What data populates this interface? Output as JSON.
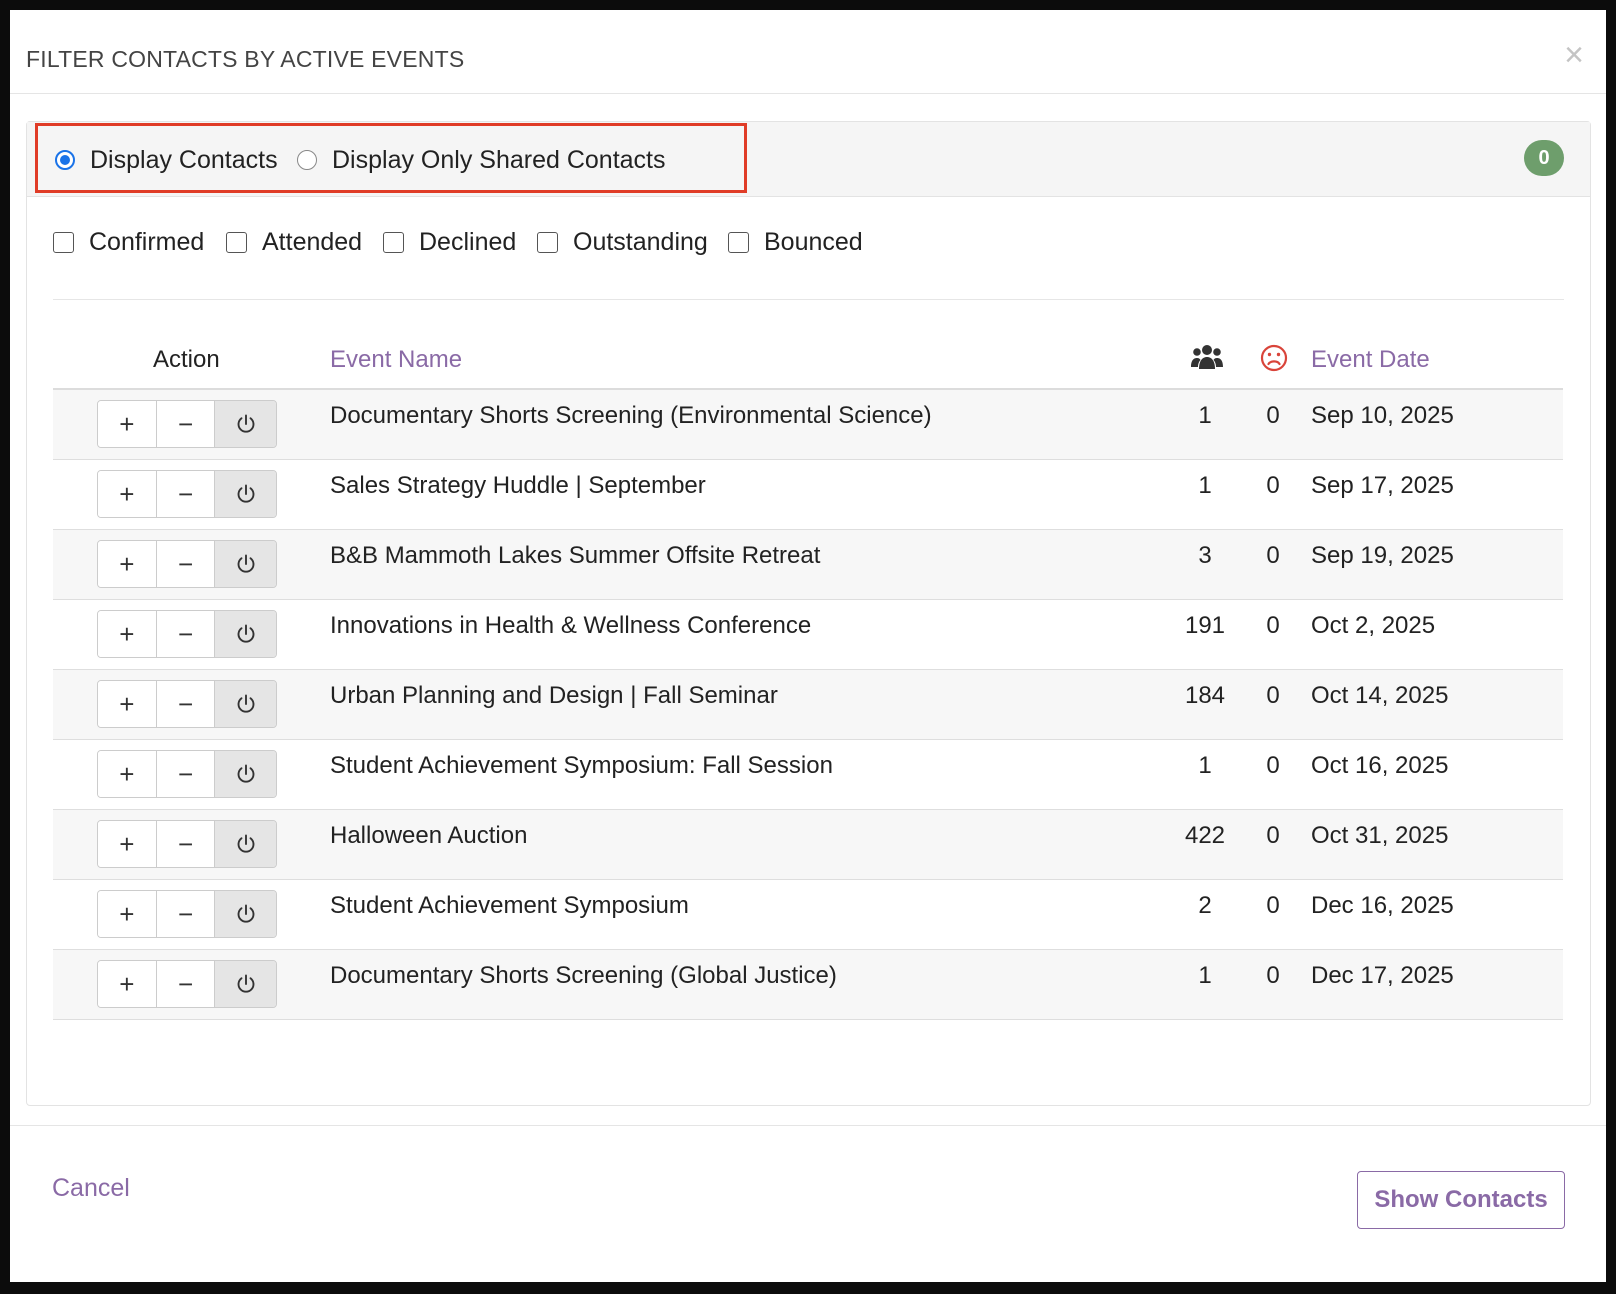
{
  "modal": {
    "title": "FILTER CONTACTS BY ACTIVE EVENTS",
    "close_label": "×"
  },
  "display": {
    "options": [
      {
        "label": "Display Contacts",
        "checked": true
      },
      {
        "label": "Display Only Shared Contacts",
        "checked": false
      }
    ],
    "count_badge": "0"
  },
  "filters": [
    "Confirmed",
    "Attended",
    "Declined",
    "Outstanding",
    "Bounced"
  ],
  "table": {
    "headers": {
      "action": "Action",
      "event_name": "Event Name",
      "attendees_icon": "group-icon",
      "declined_icon": "frown-icon",
      "event_date": "Event Date"
    },
    "buttons": {
      "plus": "+",
      "minus": "−"
    },
    "rows": [
      {
        "name": "Documentary Shorts Screening (Environmental Science)",
        "count": "1",
        "declined": "0",
        "date": "Sep 10, 2025"
      },
      {
        "name": "Sales Strategy Huddle | September",
        "count": "1",
        "declined": "0",
        "date": "Sep 17, 2025"
      },
      {
        "name": "B&B Mammoth Lakes Summer Offsite Retreat",
        "count": "3",
        "declined": "0",
        "date": "Sep 19, 2025"
      },
      {
        "name": "Innovations in Health & Wellness Conference",
        "count": "191",
        "declined": "0",
        "date": "Oct 2, 2025"
      },
      {
        "name": "Urban Planning and Design | Fall Seminar",
        "count": "184",
        "declined": "0",
        "date": "Oct 14, 2025"
      },
      {
        "name": "Student Achievement Symposium: Fall Session",
        "count": "1",
        "declined": "0",
        "date": "Oct 16, 2025"
      },
      {
        "name": "Halloween Auction",
        "count": "422",
        "declined": "0",
        "date": "Oct 31, 2025"
      },
      {
        "name": "Student Achievement Symposium",
        "count": "2",
        "declined": "0",
        "date": "Dec 16, 2025"
      },
      {
        "name": "Documentary Shorts Screening (Global Justice)",
        "count": "1",
        "declined": "0",
        "date": "Dec 17, 2025"
      }
    ]
  },
  "footer": {
    "cancel_label": "Cancel",
    "submit_label": "Show Contacts"
  },
  "colors": {
    "accent": "#8a6aa6",
    "radio_selected": "#1a73e8",
    "highlight_box": "#e03c27",
    "badge": "#6e9e6c",
    "declined_icon": "#d9443a"
  }
}
